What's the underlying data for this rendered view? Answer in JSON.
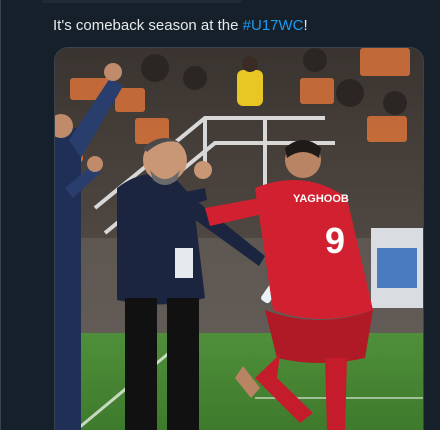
{
  "tweet": {
    "text_before": "It's comeback season at the ",
    "hashtag": "#U17WC",
    "text_after": "!"
  },
  "media": {
    "jersey_name": "YAGHOOB",
    "jersey_number": "9"
  }
}
